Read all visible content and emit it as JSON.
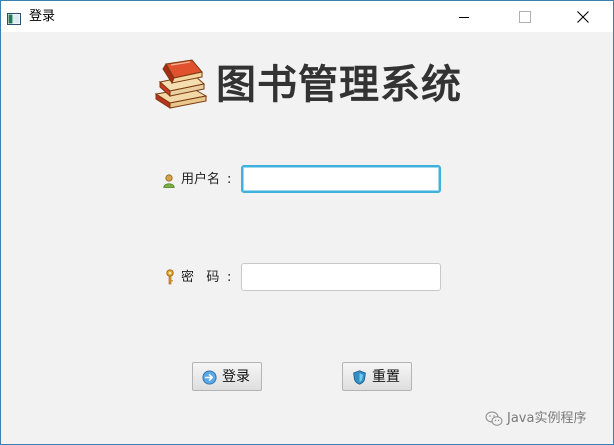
{
  "window": {
    "title": "登录",
    "accent_color": "#3c7fb1",
    "controls": [
      "minimize-icon",
      "maximize-icon",
      "close-icon"
    ]
  },
  "header": {
    "title": "图书管理系统",
    "logo_icon": "books-icon"
  },
  "form": {
    "username": {
      "label": "用户名",
      "colon": ":",
      "icon": "user-icon",
      "value": "",
      "focused": true,
      "focus_color": "#3fb1da"
    },
    "password": {
      "label": "密   码",
      "colon": ":",
      "icon": "key-icon",
      "value": ""
    }
  },
  "buttons": {
    "login": {
      "label": "登录",
      "icon": "login-arrow-icon"
    },
    "reset": {
      "label": "重置",
      "icon": "reset-shield-icon"
    }
  },
  "watermark": {
    "text": "Java实例程序",
    "icon": "wechat-icon"
  }
}
